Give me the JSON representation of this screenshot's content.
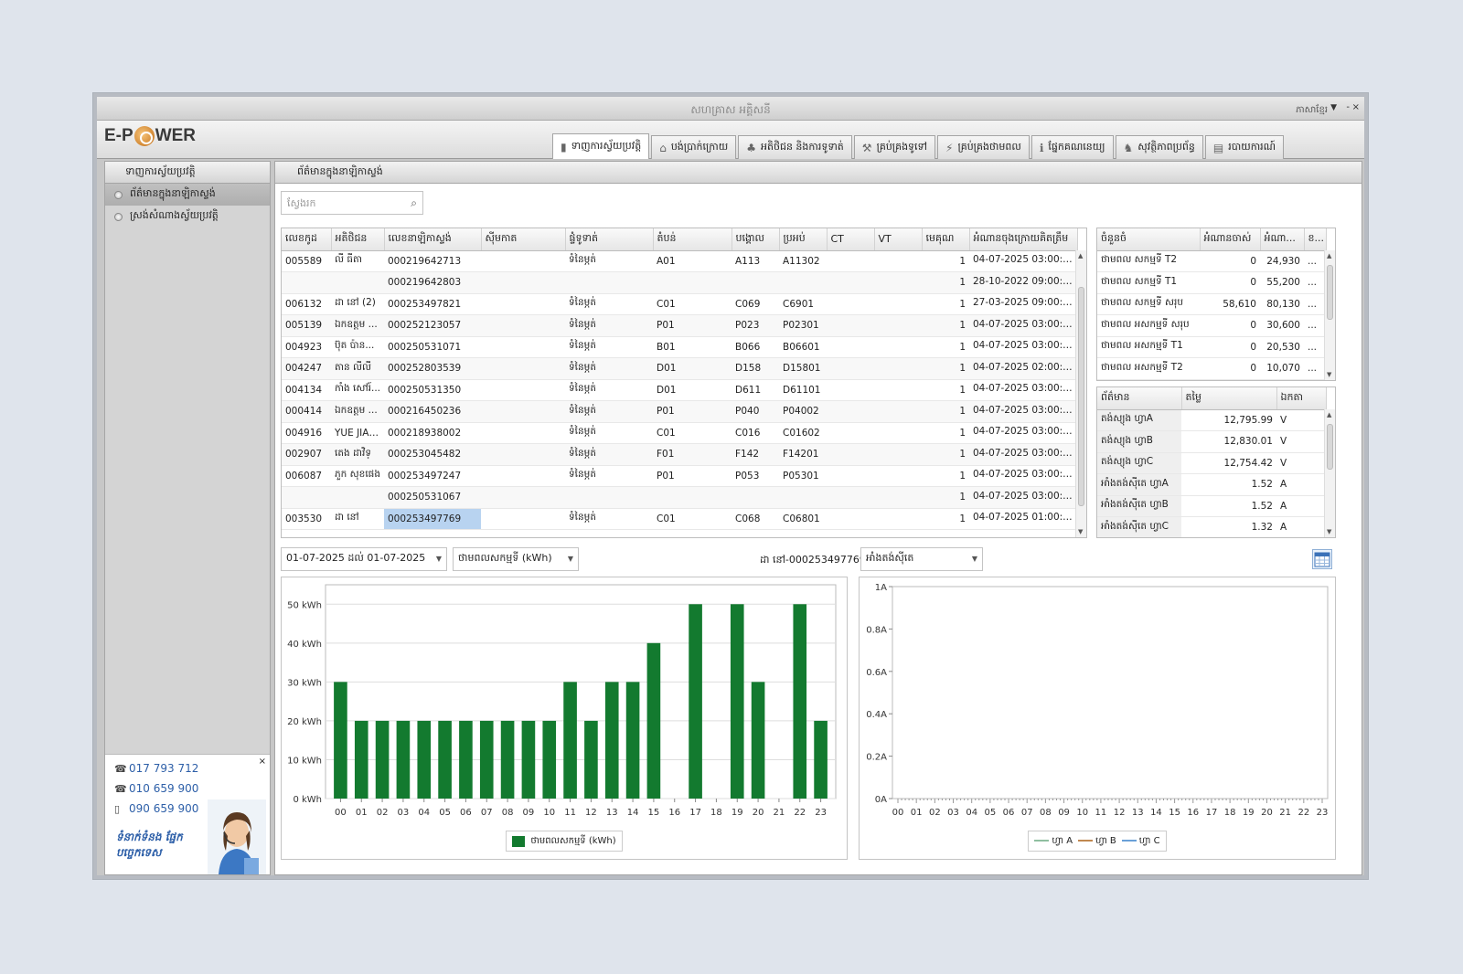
{
  "window": {
    "title": "សហគ្រាស អគ្គិសនី",
    "language": "ភាសាខ្មែរ"
  },
  "logo": {
    "part1": "E-P",
    "part2": "WER"
  },
  "tabs": [
    {
      "label": "ទាញការស្វ័យប្រវត្តិ",
      "icon": "device-icon"
    },
    {
      "label": "បង់ប្រាក់ក្រោយ",
      "icon": "home-icon"
    },
    {
      "label": "អតិថិជន និងការទូទាត់",
      "icon": "users-icon"
    },
    {
      "label": "គ្រប់គ្រងទូទៅ",
      "icon": "tools-icon"
    },
    {
      "label": "គ្រប់គ្រងថាមពល",
      "icon": "energy-icon"
    },
    {
      "label": "ផ្នែកគណនេយ្យ",
      "icon": "info-icon"
    },
    {
      "label": "សុវត្ថិភាពប្រព័ន្ធ",
      "icon": "security-icon"
    },
    {
      "label": "របាយការណ៍",
      "icon": "report-icon"
    }
  ],
  "sidebar": {
    "header": "ទាញការស្វ័យប្រវត្តិ",
    "items": [
      "ព័ត៌មានក្នុងនាឡិកាស្ទង់",
      "ស្រង់សំណាងស្វ័យប្រវត្តិ"
    ],
    "phones": [
      "017 793 712",
      "010 659 900",
      "090 659 900"
    ],
    "slogan": "ទំនាក់ទំនង ផ្នែកបច្ចេកទេស"
  },
  "main": {
    "header": "ព័ត៌មានក្នុងនាឡិកាស្ទង់",
    "search_placeholder": "ស្វែងរក"
  },
  "meter_table": {
    "columns": [
      "លេខកូដ",
      "អតិថិជន",
      "លេខនាឡិកាស្ទង់",
      "ស៊ីមកាត",
      "ផ្ទំទូទាត់",
      "តំបន់",
      "បង្គោល",
      "ប្រអប់",
      "CT",
      "VT",
      "មេគុណ",
      "អំណានចុងក្រោយគិតត្រឹម"
    ],
    "rows": [
      [
        "005589",
        "លី ធីតា",
        "000219642713",
        "",
        "ទំនៃម្ភត់",
        "A01",
        "A113",
        "A11302",
        "",
        "",
        "1",
        "04-07-2025 03:00:01 ល..."
      ],
      [
        "",
        "",
        "000219642803",
        "",
        "",
        "",
        "",
        "",
        "",
        "",
        "1",
        "28-10-2022 09:00:50 ល..."
      ],
      [
        "006132",
        "ដា នៅ (2)",
        "000253497821",
        "",
        "ទំនៃម្ភត់",
        "C01",
        "C069",
        "C6901",
        "",
        "",
        "1",
        "27-03-2025 09:00:01 ល..."
      ],
      [
        "005139",
        "ឯកឧត្តម ...",
        "000252123057",
        "",
        "ទំនៃម្ភត់",
        "P01",
        "P023",
        "P02301",
        "",
        "",
        "1",
        "04-07-2025 03:00:01 ល..."
      ],
      [
        "004923",
        "ប៊ុត ប៉ាន...",
        "000250531071",
        "",
        "ទំនៃម្ភត់",
        "B01",
        "B066",
        "B06601",
        "",
        "",
        "1",
        "04-07-2025 03:00:01 ល..."
      ],
      [
        "004247",
        "តាន លីលី",
        "000252803539",
        "",
        "ទំនៃម្ភត់",
        "D01",
        "D158",
        "D15801",
        "",
        "",
        "1",
        "04-07-2025 02:00:01 ល..."
      ],
      [
        "004134",
        "កាំង សៅរ៍...",
        "000250531350",
        "",
        "ទំនៃម្ភត់",
        "D01",
        "D611",
        "D61101",
        "",
        "",
        "1",
        "04-07-2025 03:00:01 ល..."
      ],
      [
        "000414",
        "ឯកឧត្តម ...",
        "000216450236",
        "",
        "ទំនៃម្ភត់",
        "P01",
        "P040",
        "P04002",
        "",
        "",
        "1",
        "04-07-2025 03:00:01 ល..."
      ],
      [
        "004916",
        "YUE JIAN...",
        "000218938002",
        "",
        "ទំនៃម្ភត់",
        "C01",
        "C016",
        "C01602",
        "",
        "",
        "1",
        "04-07-2025 03:00:01 ល..."
      ],
      [
        "002907",
        "តេង ដាវិទ្",
        "000253045482",
        "",
        "ទំនៃម្ភត់",
        "F01",
        "F142",
        "F14201",
        "",
        "",
        "1",
        "04-07-2025 03:00:01 ល..."
      ],
      [
        "006087",
        "ភួក សុខផេង",
        "000253497247",
        "",
        "ទំនៃម្ភត់",
        "P01",
        "P053",
        "P05301",
        "",
        "",
        "1",
        "04-07-2025 03:00:01 ល..."
      ],
      [
        "",
        "",
        "000250531067",
        "",
        "",
        "",
        "",
        "",
        "",
        "",
        "1",
        "04-07-2025 03:00:01 ល..."
      ],
      [
        "003530",
        "ដា នៅ",
        "000253497769",
        "",
        "ទំនៃម្ភត់",
        "C01",
        "C068",
        "C06801",
        "",
        "",
        "1",
        "04-07-2025 01:00:01 ល..."
      ]
    ]
  },
  "energy_table": {
    "columns": [
      "ចំនួនចំ",
      "អំណានចាស់",
      "អំណា...",
      "ខ..."
    ],
    "rows": [
      [
        "ថាមពល សកម្មទី T2",
        "0",
        "24,930",
        "..."
      ],
      [
        "ថាមពល សកម្មទី T1",
        "0",
        "55,200",
        "..."
      ],
      [
        "ថាមពល សកម្មទី សរុប",
        "58,610",
        "80,130",
        "..."
      ],
      [
        "ថាមពល អសកម្មទី សរុប",
        "0",
        "30,600",
        "..."
      ],
      [
        "ថាមពល អសកម្មទី T1",
        "0",
        "20,530",
        "..."
      ],
      [
        "ថាមពល អសកម្មទី T2",
        "0",
        "10,070",
        "..."
      ]
    ]
  },
  "info_table": {
    "columns": [
      "ព័ត៌មាន",
      "តម្លៃ",
      "ឯកតា"
    ],
    "rows": [
      [
        "តង់ស្យុង ហ្វាA",
        "12,795.99",
        "V"
      ],
      [
        "តង់ស្យុង ហ្វាB",
        "12,830.01",
        "V"
      ],
      [
        "តង់ស្យុង ហ្វាC",
        "12,754.42",
        "V"
      ],
      [
        "អាំងតង់ស៊ីតេ ហ្វាA",
        "1.52",
        "A"
      ],
      [
        "អាំងតង់ស៊ីតេ ហ្វាB",
        "1.52",
        "A"
      ],
      [
        "អាំងតង់ស៊ីតេ ហ្វាC",
        "1.32",
        "A"
      ]
    ]
  },
  "filters": {
    "date_range": "01-07-2025 ដល់ 01-07-2025",
    "energy_type": "ថាមពលសកម្មទី (kWh)",
    "meter_label": "ដា នៅ-000253497769",
    "current_type": "អាំងតង់ស៊ីតេ"
  },
  "colors": {
    "bar": "#137a2f",
    "phaseA": "#8fbfa0",
    "phaseB": "#c08850",
    "phaseC": "#6aa0d8"
  },
  "chart_data": [
    {
      "type": "bar",
      "categories": [
        "00",
        "01",
        "02",
        "03",
        "04",
        "05",
        "06",
        "07",
        "08",
        "09",
        "10",
        "11",
        "12",
        "13",
        "14",
        "15",
        "16",
        "17",
        "18",
        "19",
        "20",
        "21",
        "22",
        "23"
      ],
      "series": [
        {
          "name": "ថាមពលសកម្មទី (kWh)",
          "values": [
            30,
            20,
            20,
            20,
            20,
            20,
            20,
            20,
            20,
            20,
            20,
            30,
            20,
            30,
            30,
            40,
            0,
            50,
            0,
            50,
            30,
            0,
            50,
            20
          ]
        }
      ],
      "yticks": [
        "0 kWh",
        "10 kWh",
        "20 kWh",
        "30 kWh",
        "40 kWh",
        "50 kWh"
      ],
      "ylim": [
        0,
        55
      ],
      "grid": true,
      "legend": "bottom"
    },
    {
      "type": "line",
      "categories": [
        "00",
        "01",
        "02",
        "03",
        "04",
        "05",
        "06",
        "07",
        "08",
        "09",
        "10",
        "11",
        "12",
        "13",
        "14",
        "15",
        "16",
        "17",
        "18",
        "19",
        "20",
        "21",
        "22",
        "23"
      ],
      "series": [
        {
          "name": "ហ្វា A",
          "values": []
        },
        {
          "name": "ហ្វា B",
          "values": []
        },
        {
          "name": "ហ្វា C",
          "values": []
        }
      ],
      "yticks": [
        "0A",
        "0.2A",
        "0.4A",
        "0.6A",
        "0.8A",
        "1A"
      ],
      "ylim": [
        0,
        1
      ],
      "grid": false,
      "legend": "bottom"
    }
  ]
}
